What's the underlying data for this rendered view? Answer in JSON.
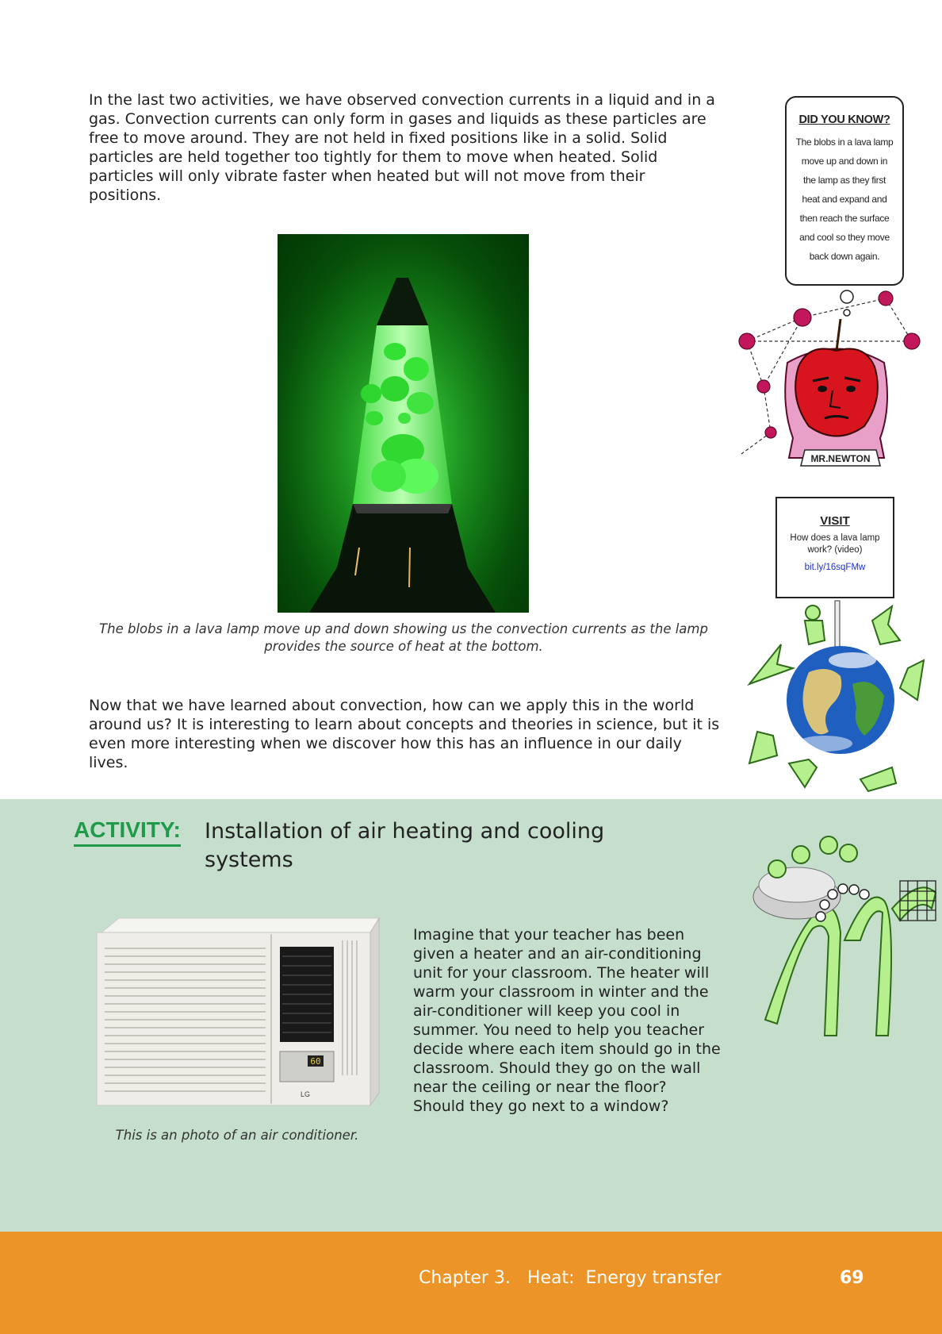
{
  "paragraphs": {
    "intro": "In the last two activities, we have observed convection currents in a liquid and in a gas. Convection currents can only form in gases and liquids as these particles are free to move around. They are not held in fixed positions like in a solid. Solid particles are held together too tightly for them to move when heated. Solid particles will only vibrate faster when heated but will not move from their positions.",
    "application": "Now that we have learned about convection, how can we apply this in the world around us? It is interesting to learn about concepts and theories in science, but it is even more interesting when we discover how this has an influence in our daily lives."
  },
  "lava_lamp": {
    "caption": "The blobs in a lava lamp move up and down showing us the convection currents as the lamp provides the source of heat at the bottom."
  },
  "did_you_know": {
    "title": "DID YOU KNOW?",
    "text": "The blobs in a lava lamp move up and down in the lamp as they first heat and expand and then reach the surface and cool so they move back down again."
  },
  "newton": {
    "banner": "MR.NEWTON"
  },
  "visit": {
    "title": "VISIT",
    "text": "How does a lava lamp work? (video)",
    "link": "bit.ly/16sqFMw"
  },
  "activity": {
    "label": "ACTIVITY:",
    "title": "Installation of air heating and cooling systems",
    "text": "Imagine that your teacher has been given a heater and an air-conditioning unit for your classroom. The heater will warm your classroom in winter and the air-conditioner will keep you cool in summer. You need to help you teacher decide where each item should go in the classroom. Should they go on the wall near the ceiling or near the floor? Should they go next to a window?",
    "ac_caption": "This is an photo of an air conditioner.",
    "ac_display": "60",
    "ac_brand": "LG"
  },
  "footer": {
    "chapter": "Chapter 3.   Heat:  Energy transfer",
    "page": "69"
  },
  "colors": {
    "activity_green": "#1f9a4a",
    "band_bg": "#c6dfcd",
    "footer_orange": "#ec9427",
    "link_blue": "#1a2fd1"
  }
}
